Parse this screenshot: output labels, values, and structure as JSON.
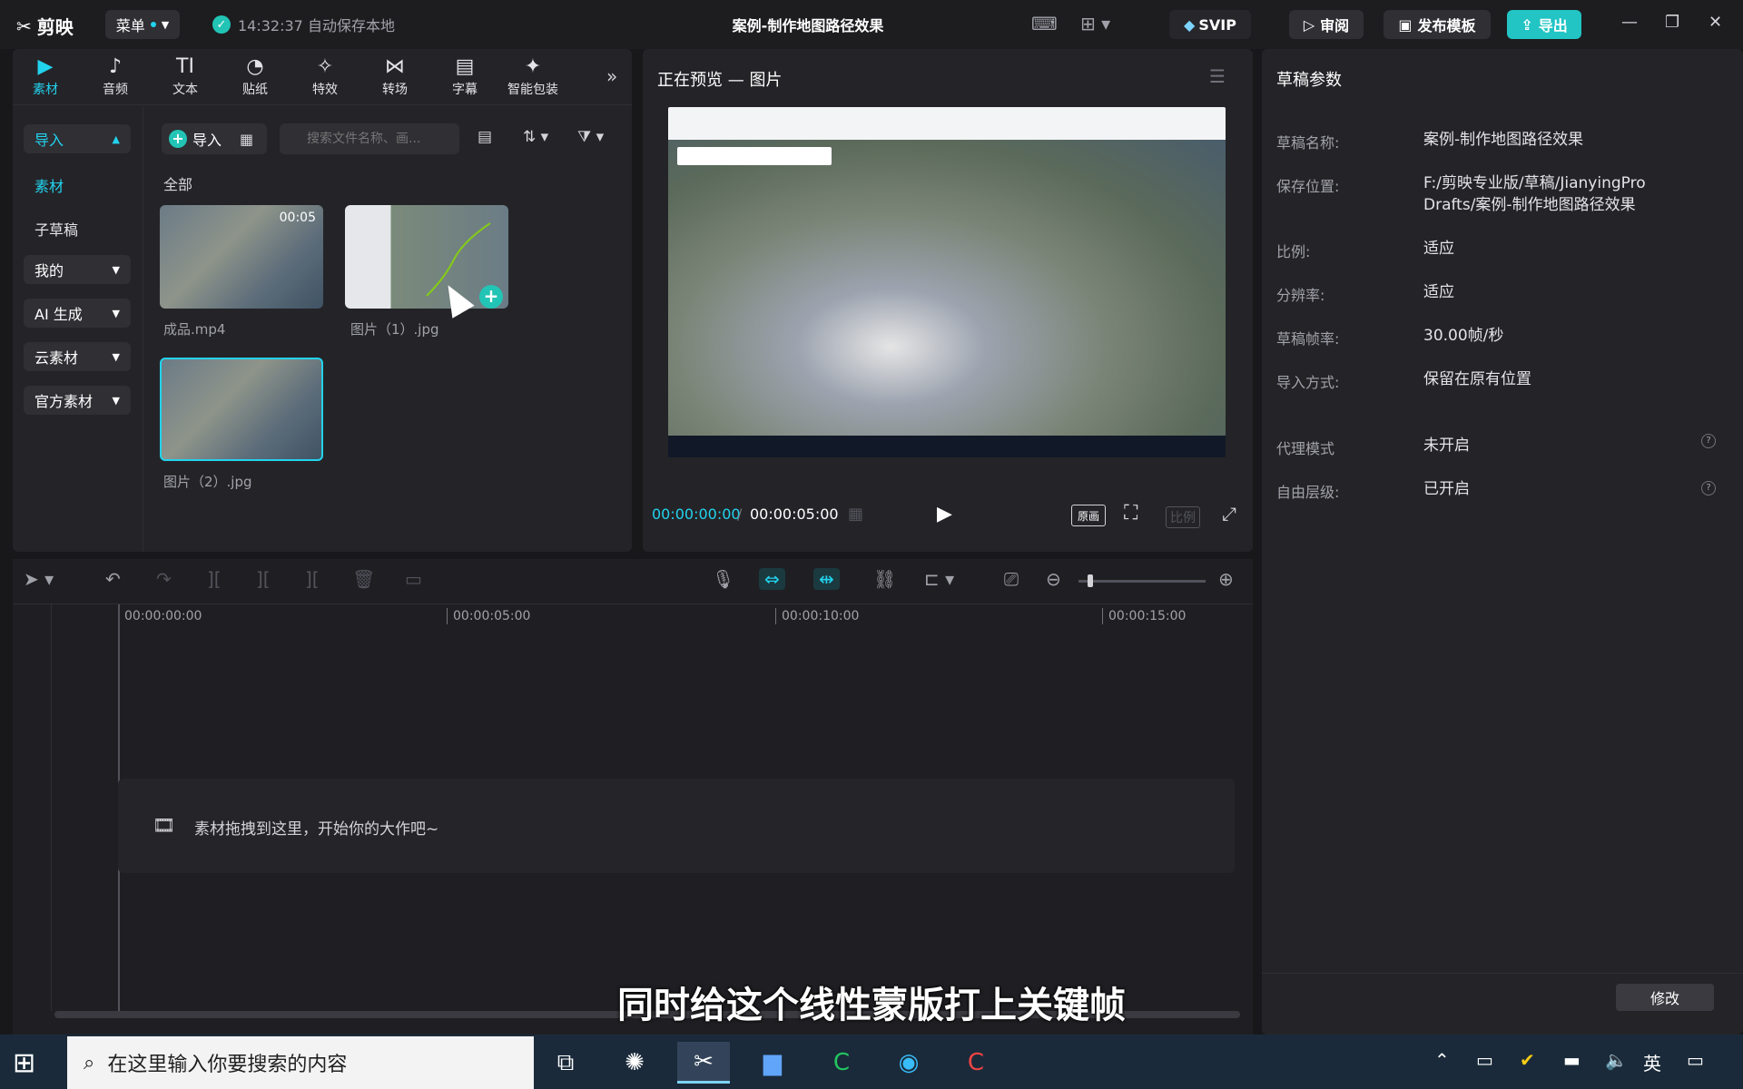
{
  "app": {
    "name": "剪映",
    "menu_label": "菜单",
    "autosave_text": "14:32:37 自动保存本地",
    "window_title": "案例-制作地图路径效果",
    "svip_label": "SVIP",
    "review_label": "审阅",
    "publish_label": "发布模板",
    "export_label": "导出"
  },
  "media_tabs": [
    {
      "label": "素材",
      "icon": "▶"
    },
    {
      "label": "音频",
      "icon": "♪"
    },
    {
      "label": "文本",
      "icon": "TI"
    },
    {
      "label": "贴纸",
      "icon": "◔"
    },
    {
      "label": "特效",
      "icon": "✧"
    },
    {
      "label": "转场",
      "icon": "⋈"
    },
    {
      "label": "字幕",
      "icon": "▤"
    },
    {
      "label": "智能包装",
      "icon": "✦"
    }
  ],
  "library_sidebar": {
    "import_label": "导入",
    "material_label": "素材",
    "subdraft_label": "子草稿",
    "mine_label": "我的",
    "ai_label": "AI 生成",
    "cloud_label": "云素材",
    "official_label": "官方素材"
  },
  "library": {
    "import_button": "导入",
    "search_placeholder": "搜索文件名称、画...",
    "all_label": "全部",
    "items": [
      {
        "name": "成品.mp4",
        "duration": "00:05"
      },
      {
        "name": "图片（1）.jpg",
        "duration": ""
      },
      {
        "name": "图片（2）.jpg",
        "duration": ""
      }
    ]
  },
  "preview": {
    "title": "正在预览 — 图片",
    "current_time": "00:00:00:00",
    "total_time": "00:00:05:00",
    "original_label": "原画",
    "ratio_label": "比例"
  },
  "draft_params": {
    "title": "草稿参数",
    "rows": [
      {
        "key": "草稿名称:",
        "value": "案例-制作地图路径效果"
      },
      {
        "key": "保存位置:",
        "value": "F:/剪映专业版/草稿/JianyingPro Drafts/案例-制作地图路径效果"
      },
      {
        "key": "比例:",
        "value": "适应"
      },
      {
        "key": "分辨率:",
        "value": "适应"
      },
      {
        "key": "草稿帧率:",
        "value": "30.00帧/秒"
      },
      {
        "key": "导入方式:",
        "value": "保留在原有位置"
      },
      {
        "key": "代理模式",
        "value": "未开启"
      },
      {
        "key": "自由层级:",
        "value": "已开启"
      }
    ],
    "modify_label": "修改"
  },
  "timeline": {
    "ruler": [
      "00:00:00:00",
      "00:00:05:00",
      "00:00:10:00",
      "00:00:15:00"
    ],
    "drop_hint": "素材拖拽到这里，开始你的大作吧~"
  },
  "subtitle_overlay": "同时给这个线性蒙版打上关键帧",
  "taskbar": {
    "search_placeholder": "在这里输入你要搜索的内容",
    "ime_label": "英"
  }
}
